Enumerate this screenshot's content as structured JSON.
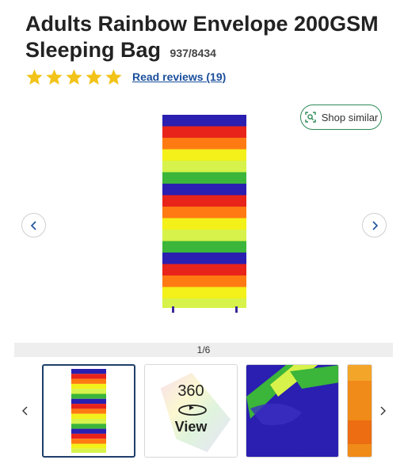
{
  "product": {
    "title": "Adults Rainbow Envelope 200GSM Sleeping Bag",
    "sku": "937/8434"
  },
  "rating": {
    "stars": 5,
    "max_stars": 5,
    "reviews_label": "Read reviews (19)"
  },
  "gallery": {
    "shop_similar_label": "Shop similar",
    "pager_text": "1/6",
    "stripe_colors": [
      "#2a1fb0",
      "#e8231a",
      "#ff7a12",
      "#f3f01a",
      "#d7f24a",
      "#3bb53a",
      "#7a2fd0"
    ],
    "thumbnails": [
      {
        "kind": "image",
        "active": true
      },
      {
        "kind": "360",
        "number": "360",
        "view": "View",
        "active": false
      },
      {
        "kind": "image",
        "active": false
      },
      {
        "kind": "image",
        "active": false
      }
    ]
  },
  "colors": {
    "link": "#1a4f9c",
    "star": "#f2c318",
    "shop_similar_border": "#2e8b57",
    "active_thumb_border": "#1f3f6b"
  },
  "icons": [
    "star-icon",
    "image-search-icon",
    "chevron-left-icon",
    "chevron-right-icon",
    "rotate-360-icon"
  ]
}
